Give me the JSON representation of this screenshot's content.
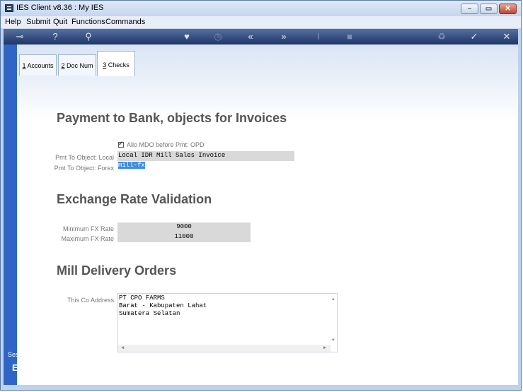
{
  "window": {
    "title": "IES Client v8.36 : My IES"
  },
  "menu": [
    "Help",
    "Submit",
    "Quit",
    "Functions",
    "Commands"
  ],
  "toolbar": {
    "icons": [
      "key-icon",
      "help-icon",
      "search-icon",
      "heart-icon",
      "clock-icon",
      "rewind-icon",
      "fast-forward-icon",
      "text-cursor-icon",
      "stop-icon",
      "recycle-icon",
      "check-icon",
      "close-icon"
    ]
  },
  "tabs": [
    {
      "num": "1",
      "label": " Accounts"
    },
    {
      "num": "2",
      "label": " Doc Num"
    },
    {
      "num": "3",
      "label": " Checks"
    }
  ],
  "sections": {
    "payment": {
      "title": "Payment to Bank, objects for Invoices",
      "checkbox_label": "Allo MDO before Pmt: OPD",
      "checkbox_checked": true,
      "local_label": "Pmt To Object: Local",
      "local_value": "Local IDR Mill Sales Invoice",
      "forex_label": "Pmt To Object: Forex",
      "forex_value": "mill-fx"
    },
    "exchange": {
      "title": "Exchange Rate Validation",
      "min_label": "Minimum FX Rate",
      "min_value": "9000",
      "max_label": "Maximum FX Rate",
      "max_value": "11000"
    },
    "mdo": {
      "title": "Mill Delivery Orders",
      "address_label": "This Co Address",
      "address_lines": [
        "PT CPO FARMS",
        "Barat - Kabupaten Lahat",
        "Sumatera Selatan"
      ]
    }
  },
  "sidebar": {
    "session_text": "Ses",
    "session_glyph": "E"
  }
}
